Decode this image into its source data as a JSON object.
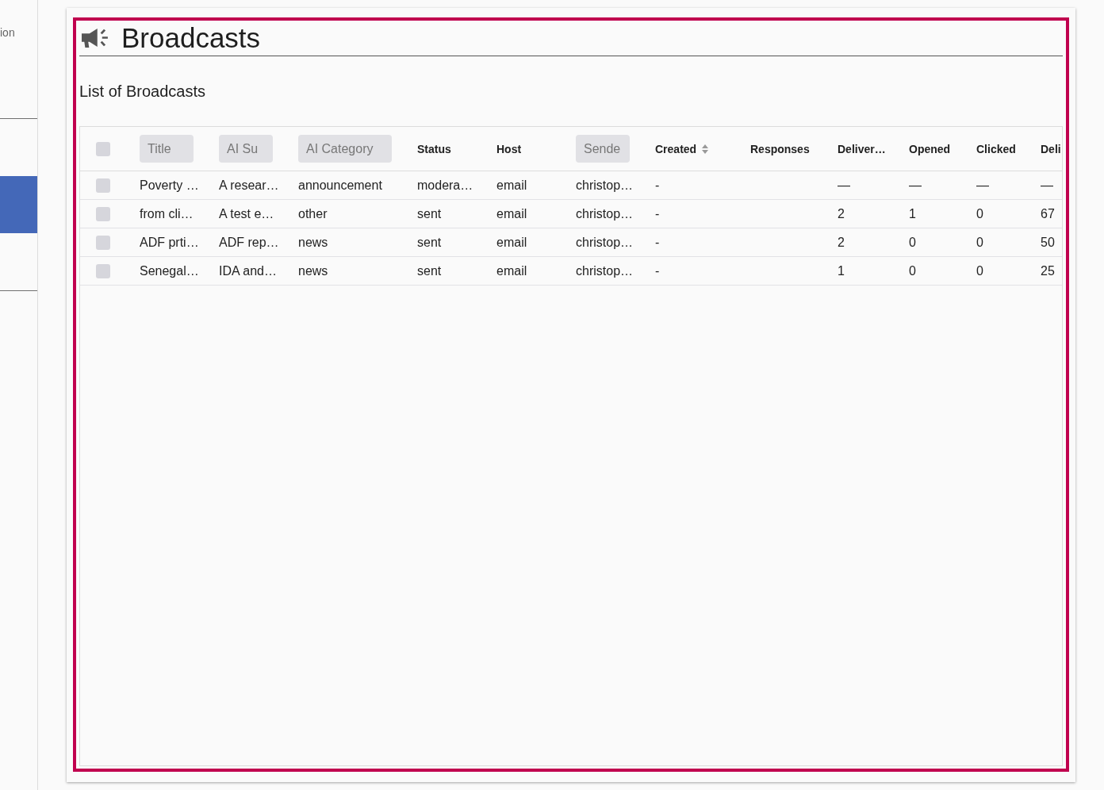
{
  "sidebar": {
    "groups": [
      {
        "items": [
          {
            "label": "ion",
            "selected": false
          }
        ]
      },
      {
        "items": [
          {
            "selected": true
          }
        ]
      }
    ]
  },
  "page": {
    "title": "Broadcasts",
    "subtitle": "List of Broadcasts"
  },
  "table": {
    "select_all": {
      "checked": false
    },
    "columns": [
      {
        "label": "Title",
        "kind": "chip",
        "sortable": false
      },
      {
        "label": "AI Su",
        "kind": "chip",
        "sortable": false
      },
      {
        "label": "AI Category",
        "kind": "chip",
        "sortable": false
      },
      {
        "label": "Status",
        "kind": "text",
        "sortable": false
      },
      {
        "label": "Host",
        "kind": "text",
        "sortable": false
      },
      {
        "label": "Sende",
        "kind": "chip",
        "sortable": false
      },
      {
        "label": "Created",
        "kind": "text",
        "sortable": true
      },
      {
        "label": "Responses",
        "kind": "text",
        "sortable": false
      },
      {
        "label": "Deliver…",
        "kind": "text",
        "sortable": false
      },
      {
        "label": "Opened",
        "kind": "text",
        "sortable": false
      },
      {
        "label": "Clicked",
        "kind": "text",
        "sortable": false
      },
      {
        "label": "Deli",
        "kind": "text",
        "sortable": false
      }
    ],
    "rows": [
      {
        "checked": false,
        "cells": [
          "Poverty …",
          "A resear…",
          "announcement",
          "modera…",
          "email",
          "christop…",
          "-",
          null,
          "—",
          "—",
          "—",
          "—"
        ]
      },
      {
        "checked": false,
        "cells": [
          "from cli…",
          "A test e…",
          "other",
          "sent",
          "email",
          "christop…",
          "-",
          null,
          "2",
          "1",
          "0",
          "67"
        ]
      },
      {
        "checked": false,
        "cells": [
          "ADF prti…",
          "ADF rep…",
          "news",
          "sent",
          "email",
          "christop…",
          "-",
          null,
          "2",
          "0",
          "0",
          "50"
        ]
      },
      {
        "checked": false,
        "cells": [
          "Senegal…",
          "IDA and…",
          "news",
          "sent",
          "email",
          "christop…",
          "-",
          null,
          "1",
          "0",
          "0",
          "25"
        ]
      }
    ]
  }
}
